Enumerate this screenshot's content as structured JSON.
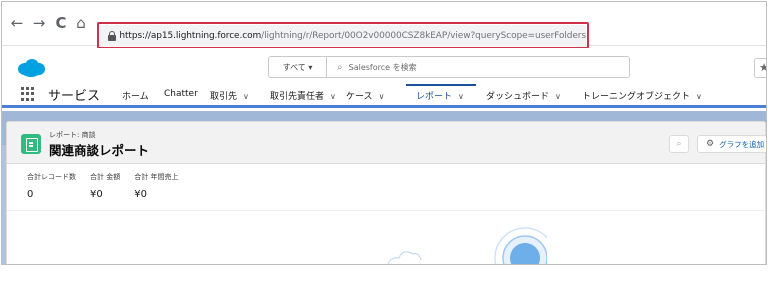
{
  "browser": {
    "back": "←",
    "forward": "→",
    "reload": "C",
    "home": "⌂",
    "url_domain": "https://ap15.lightning.force.com",
    "url_path": "/lightning/r/Report/00O2v00000CSZ8kEAP/view?queryScope=userFolders"
  },
  "header": {
    "search_scope": "すべて ▾",
    "search_placeholder": "Salesforce を検索",
    "favorites_icon": "★"
  },
  "nav": {
    "app_name": "サービス",
    "items": [
      {
        "label": "ホーム",
        "chevron": ""
      },
      {
        "label": "Chatter",
        "chevron": ""
      },
      {
        "label": "取引先",
        "chevron": "∨"
      },
      {
        "label": "取引先責任者",
        "chevron": "∨"
      },
      {
        "label": "ケース",
        "chevron": "∨"
      },
      {
        "label": "レポート",
        "chevron": "∨"
      },
      {
        "label": "ダッシュボード",
        "chevron": "∨"
      },
      {
        "label": "トレーニングオブジェクト",
        "chevron": "∨"
      }
    ],
    "active_index": 5
  },
  "report": {
    "breadcrumb": "レポート: 商談",
    "title": "関連商談レポート",
    "search_icon": "🔍",
    "add_chart_label": "グラフを追加",
    "summary": [
      {
        "label": "合計レコード数",
        "value": "0"
      },
      {
        "label": "合計 金額",
        "value": "¥0"
      },
      {
        "label": "合計 年間売上",
        "value": "¥0"
      }
    ]
  },
  "colors": {
    "url_highlight": "#d0314a",
    "salesforce_blue": "#00a1e0",
    "report_icon": "#2fbc7e",
    "nav_accent": "#1b5297"
  }
}
